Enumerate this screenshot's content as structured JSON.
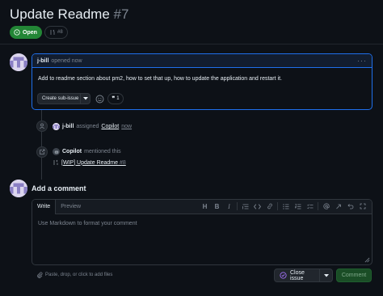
{
  "issue": {
    "title": "Update Readme",
    "number": "#7",
    "state_label": "Open",
    "linked_pr_count": "#8"
  },
  "comment": {
    "author": "j-bill",
    "meta": "opened now",
    "body": "Add to readme section about pm2, how to set that up, how to update the application and restart it.",
    "create_subissue_label": "Create sub-issue",
    "reaction_count": "1"
  },
  "timeline": {
    "assigned": {
      "actor": "j-bill",
      "verb": "assigned",
      "assignee": "Copilot",
      "time": "now"
    },
    "mentioned": {
      "actor": "Copilot",
      "verb": "mentioned this",
      "pr_title": "[WIP] Update Readme",
      "pr_number": "#8"
    }
  },
  "composer": {
    "heading": "Add a comment",
    "tabs": [
      "Write",
      "Preview"
    ],
    "placeholder": "Use Markdown to format your comment",
    "paste_hint": "Paste, drop, or click to add files",
    "close_issue_label": "Close issue",
    "comment_label": "Comment",
    "toolbar_icons": [
      "heading-icon",
      "bold-icon",
      "italic-icon",
      "quote-icon",
      "code-icon",
      "link-icon",
      "unordered-list-icon",
      "ordered-list-icon",
      "task-list-icon",
      "mention-icon",
      "reference-icon",
      "undo-icon",
      "fullscreen-icon"
    ]
  },
  "colors": {
    "background": "#0d1117",
    "open_green": "#238636",
    "accent_blue": "#1f6feb",
    "muted": "#7d8590",
    "border": "#30363d"
  }
}
